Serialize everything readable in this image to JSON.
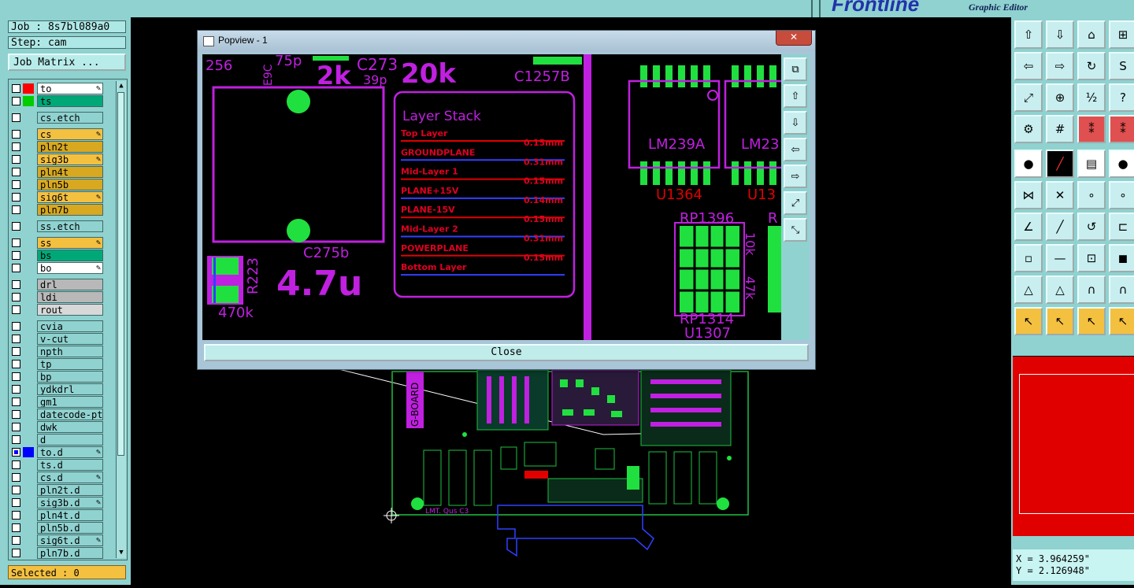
{
  "brand": {
    "logo": "Frontline",
    "subtitle": "Graphic Editor"
  },
  "job": {
    "label": "Job : 8s7bl089a0",
    "step": "Step: cam"
  },
  "job_matrix": "Job Matrix ...",
  "layers": [
    {
      "name": "to",
      "color": "#ff0000",
      "bg": "#ffffff",
      "checked": false,
      "edit": true
    },
    {
      "name": "ts",
      "color": "#00cc00",
      "bg": "#00a878",
      "checked": false,
      "edit": false
    },
    {
      "name": "cs.etch",
      "color": "",
      "bg": "#8fd2d0",
      "checked": false,
      "edit": false,
      "gap": true
    },
    {
      "name": "cs",
      "color": "",
      "bg": "#f4c040",
      "checked": false,
      "edit": true,
      "gap": true
    },
    {
      "name": "pln2t",
      "color": "",
      "bg": "#d8a820",
      "checked": false,
      "edit": false
    },
    {
      "name": "sig3b",
      "color": "",
      "bg": "#f4c040",
      "checked": false,
      "edit": true
    },
    {
      "name": "pln4t",
      "color": "",
      "bg": "#d8a820",
      "checked": false,
      "edit": false
    },
    {
      "name": "pln5b",
      "color": "",
      "bg": "#d8a820",
      "checked": false,
      "edit": false
    },
    {
      "name": "sig6t",
      "color": "",
      "bg": "#f4c040",
      "checked": false,
      "edit": true
    },
    {
      "name": "pln7b",
      "color": "",
      "bg": "#d8a820",
      "checked": false,
      "edit": false
    },
    {
      "name": "ss.etch",
      "color": "",
      "bg": "#8fd2d0",
      "checked": false,
      "edit": false,
      "gap": true
    },
    {
      "name": "ss",
      "color": "",
      "bg": "#f4c040",
      "checked": false,
      "edit": true,
      "gap": true
    },
    {
      "name": "bs",
      "color": "",
      "bg": "#00a878",
      "checked": false,
      "edit": false
    },
    {
      "name": "bo",
      "color": "",
      "bg": "#ffffff",
      "checked": false,
      "edit": true
    },
    {
      "name": "drl",
      "color": "",
      "bg": "#b8b8b8",
      "checked": false,
      "edit": false,
      "gap": true
    },
    {
      "name": "ldi",
      "color": "",
      "bg": "#b8b8b8",
      "checked": false,
      "edit": false
    },
    {
      "name": "rout",
      "color": "",
      "bg": "#d8d8d8",
      "checked": false,
      "edit": false
    },
    {
      "name": "cvia",
      "color": "",
      "bg": "#8fd2d0",
      "checked": false,
      "edit": false,
      "gap": true
    },
    {
      "name": "v-cut",
      "color": "",
      "bg": "#8fd2d0",
      "checked": false,
      "edit": false
    },
    {
      "name": "npth",
      "color": "",
      "bg": "#8fd2d0",
      "checked": false,
      "edit": false
    },
    {
      "name": "tp",
      "color": "",
      "bg": "#8fd2d0",
      "checked": false,
      "edit": false
    },
    {
      "name": "bp",
      "color": "",
      "bg": "#8fd2d0",
      "checked": false,
      "edit": false
    },
    {
      "name": "ydkdrl",
      "color": "",
      "bg": "#8fd2d0",
      "checked": false,
      "edit": false
    },
    {
      "name": "gm1",
      "color": "",
      "bg": "#8fd2d0",
      "checked": false,
      "edit": false
    },
    {
      "name": "datecode-pte",
      "color": "",
      "bg": "#8fd2d0",
      "checked": false,
      "edit": false
    },
    {
      "name": "dwk",
      "color": "",
      "bg": "#8fd2d0",
      "checked": false,
      "edit": false
    },
    {
      "name": "d",
      "color": "",
      "bg": "#8fd2d0",
      "checked": false,
      "edit": false
    },
    {
      "name": "to.d",
      "color": "#0000ff",
      "bg": "#8fd2d0",
      "checked": true,
      "edit": true
    },
    {
      "name": "ts.d",
      "color": "",
      "bg": "#8fd2d0",
      "checked": false,
      "edit": false
    },
    {
      "name": "cs.d",
      "color": "",
      "bg": "#8fd2d0",
      "checked": false,
      "edit": true
    },
    {
      "name": "pln2t.d",
      "color": "",
      "bg": "#8fd2d0",
      "checked": false,
      "edit": false
    },
    {
      "name": "sig3b.d",
      "color": "",
      "bg": "#8fd2d0",
      "checked": false,
      "edit": true
    },
    {
      "name": "pln4t.d",
      "color": "",
      "bg": "#8fd2d0",
      "checked": false,
      "edit": false
    },
    {
      "name": "pln5b.d",
      "color": "",
      "bg": "#8fd2d0",
      "checked": false,
      "edit": false
    },
    {
      "name": "sig6t.d",
      "color": "",
      "bg": "#8fd2d0",
      "checked": false,
      "edit": true
    },
    {
      "name": "pln7b.d",
      "color": "",
      "bg": "#8fd2d0",
      "checked": false,
      "edit": false
    }
  ],
  "selected": "Selected : 0",
  "popup": {
    "title": "Popview - 1",
    "close_x": "✕",
    "close_button": "Close",
    "pcb_text": {
      "t256": "256",
      "t75p": "75p",
      "t2k": "2k",
      "c273": "C273",
      "t39p": "39p",
      "t20k": "20k",
      "c1257b": "C1257B",
      "c275b": "C275b",
      "r223": "R223",
      "t470k": "470k",
      "t47u": "4.7u",
      "e9c": "E9C",
      "lm239a": "LM239A",
      "lm23": "LM23",
      "u1364": "U1364",
      "u13": "U13",
      "rp1396": "RP1396",
      "r": "R",
      "t10k": "10k",
      "t47k": "47k",
      "rp1314": "RP1314",
      "u1307": "U1307"
    },
    "layer_stack": {
      "title": "Layer Stack",
      "rows": [
        {
          "name": "Top Layer",
          "thickness": "0.15mm"
        },
        {
          "name": "GROUNDPLANE",
          "thickness": "0.31mm"
        },
        {
          "name": "Mid-Layer 1",
          "thickness": "0.15mm"
        },
        {
          "name": "PLANE+15V",
          "thickness": "0.14mm"
        },
        {
          "name": "PLANE-15V",
          "thickness": "0.15mm"
        },
        {
          "name": "Mid-Layer 2",
          "thickness": "0.31mm"
        },
        {
          "name": "POWERPLANE",
          "thickness": "0.15mm"
        },
        {
          "name": "Bottom Layer",
          "thickness": ""
        }
      ]
    }
  },
  "board": {
    "name": "G-BOARD",
    "label": "LMT. Qus C3"
  },
  "coords": {
    "x": "X = 3.964259\"",
    "y": "Y = 2.126948\""
  },
  "colors": {
    "panel": "#8fd2d0",
    "overview": "#e00000",
    "magenta": "#c020e0",
    "pad": "#00e040"
  }
}
